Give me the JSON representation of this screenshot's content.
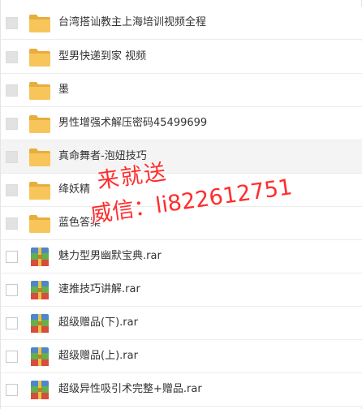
{
  "files": [
    {
      "name": "台湾搭讪教主上海培训视频全程",
      "type": "folder"
    },
    {
      "name": "型男快递到家 视频",
      "type": "folder"
    },
    {
      "name": "墨",
      "type": "folder"
    },
    {
      "name": "男性增强术解压密码45499699",
      "type": "folder"
    },
    {
      "name": "真命舞者-泡妞技巧",
      "type": "folder"
    },
    {
      "name": "绛妖精",
      "type": "folder"
    },
    {
      "name": "蓝色答案",
      "type": "folder"
    },
    {
      "name": "魅力型男幽默宝典.rar",
      "type": "rar"
    },
    {
      "name": "速推技巧讲解.rar",
      "type": "rar"
    },
    {
      "name": "超级赠品(下).rar",
      "type": "rar"
    },
    {
      "name": "超级赠品(上).rar",
      "type": "rar"
    },
    {
      "name": "超级异性吸引术完整+赠品.rar",
      "type": "rar"
    }
  ],
  "watermark": {
    "line1": "来就送",
    "line2": "威信：li822612751",
    "color": "#ff2d2d"
  },
  "colors": {
    "folder": "#f7c55a",
    "folder_dark": "#e8ad3c",
    "row_hover": "#f4f4f4",
    "checkbox_gray": "#e2e2e2"
  },
  "icons": {
    "folder": "folder-icon",
    "rar": "rar-archive-icon"
  }
}
